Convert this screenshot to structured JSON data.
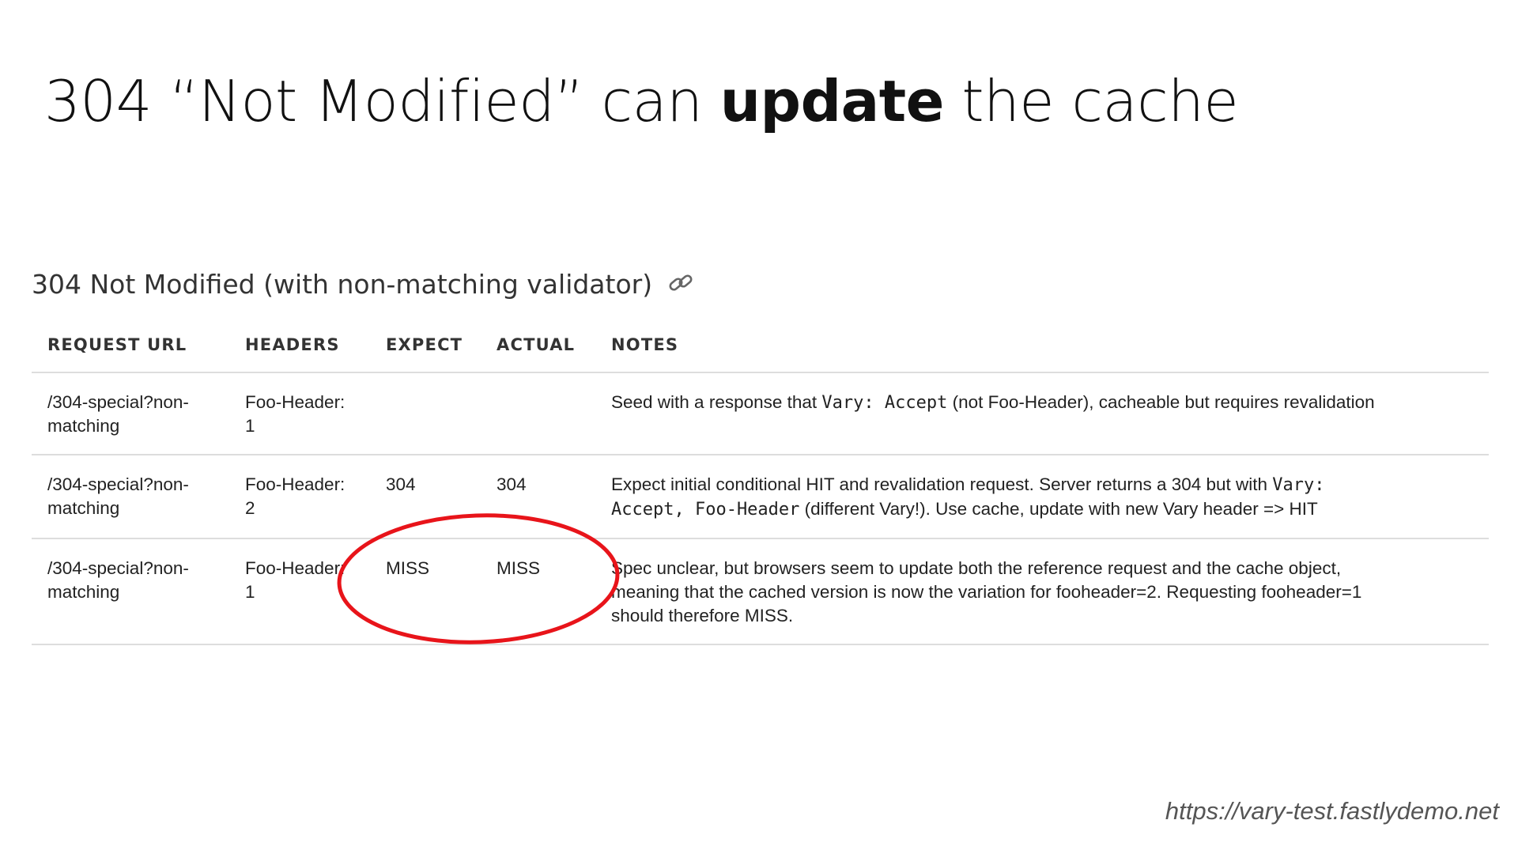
{
  "slide": {
    "title_before": "304 “Not Modified” can ",
    "title_bold": "update",
    "title_after": " the cache"
  },
  "section": {
    "heading": "304 Not Modified (with non-matching validator)",
    "link_icon": "link-icon"
  },
  "table": {
    "columns": [
      "REQUEST URL",
      "HEADERS",
      "EXPECT",
      "ACTUAL",
      "NOTES"
    ],
    "rows": [
      {
        "url_line1": "/304-special?non-",
        "url_line2": "matching",
        "headers_line1": "Foo-Header:",
        "headers_line2": "1",
        "expect": "",
        "actual": "",
        "notes": {
          "pre": "Seed with a response that ",
          "code1": "Vary: Accept",
          "post": " (not Foo-Header), cacheable but requires revalidation"
        }
      },
      {
        "url_line1": "/304-special?non-",
        "url_line2": "matching",
        "headers_line1": "Foo-Header:",
        "headers_line2": "2",
        "expect": "304",
        "actual": "304",
        "notes": {
          "pre": "Expect initial conditional HIT and revalidation request. Server returns a 304 but with ",
          "code1": "Vary:",
          "code2": "Accept, Foo-Header",
          "post": " (different Vary!). Use cache, update with new Vary header => HIT"
        }
      },
      {
        "url_line1": "/304-special?non-",
        "url_line2": "matching",
        "headers_line1": "Foo-Header:",
        "headers_line2": "1",
        "expect": "MISS",
        "actual": "MISS",
        "notes": {
          "line1": "Spec unclear, but browsers seem to update both the reference request and the cache object,",
          "line2": "meaning that the cached version is now the variation for fooheader=2. Requesting fooheader=1",
          "line3": "should therefore MISS."
        }
      }
    ]
  },
  "annotation": {
    "shape": "ellipse",
    "color": "#e8141a",
    "target": "EXPECT / ACTUAL of row 3"
  },
  "footer": {
    "url": "https://vary-test.fastlydemo.net"
  }
}
